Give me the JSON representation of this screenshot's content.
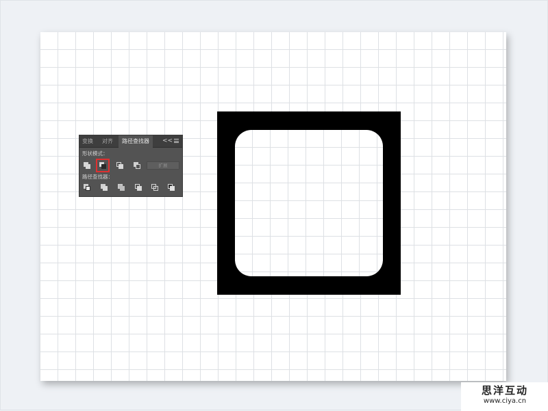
{
  "panel": {
    "tabs": [
      "变换",
      "对齐",
      "路径查找器"
    ],
    "active_tab": "路径查找器",
    "collapse_label": "<<",
    "shape_modes_label": "形状模式：",
    "pathfinders_label": "路径查找器：",
    "expand_label": "扩展",
    "highlighted_button": "minus-front",
    "shape_mode_buttons": [
      "unite-icon",
      "minus-front-icon",
      "intersect-icon",
      "exclude-icon"
    ],
    "pathfinder_buttons": [
      "divide-icon",
      "trim-icon",
      "merge-icon",
      "crop-icon",
      "outline-icon",
      "minus-back-icon"
    ]
  },
  "watermark": {
    "title": "思洋互动",
    "url": "www.ciya.cn"
  },
  "colors": {
    "background": "#eef1f5",
    "artboard": "#ffffff",
    "grid": "#dde0e4",
    "shape": "#000000",
    "panel": "#535353",
    "highlight": "#e03030"
  }
}
